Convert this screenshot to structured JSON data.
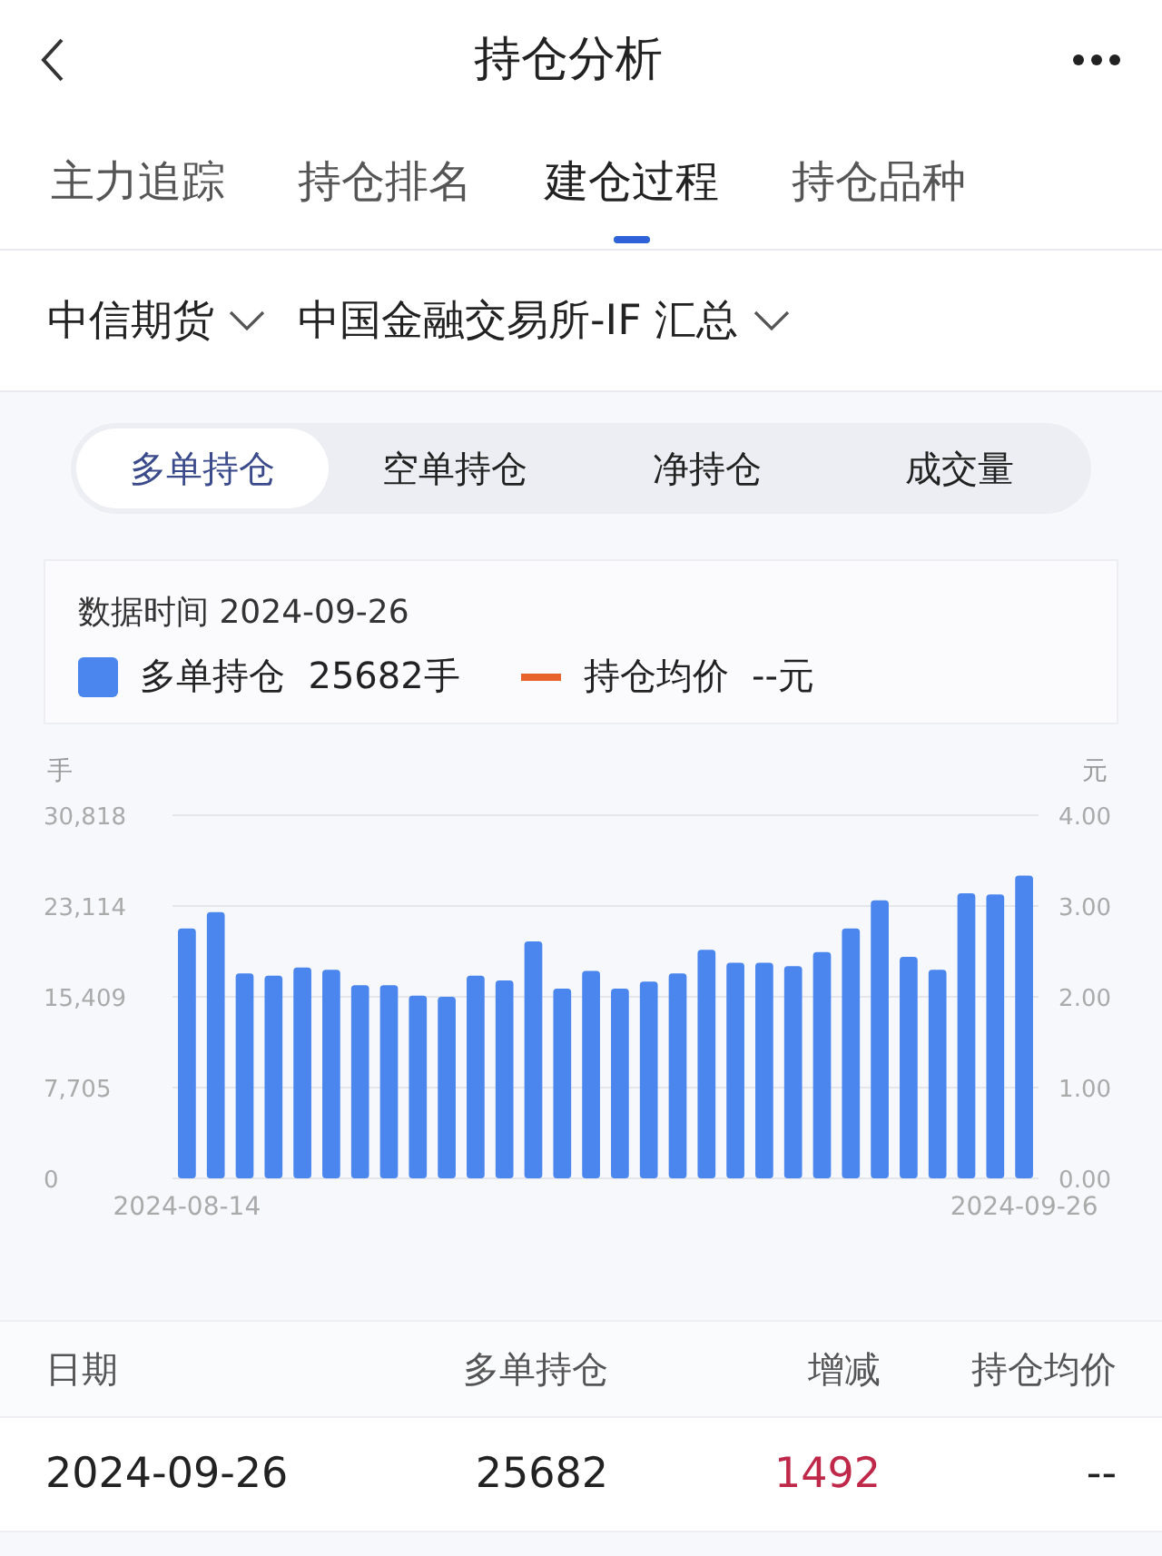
{
  "header": {
    "title": "持仓分析"
  },
  "tabs": [
    {
      "label": "主力追踪",
      "selected": false
    },
    {
      "label": "持仓排名",
      "selected": false
    },
    {
      "label": "建仓过程",
      "selected": true
    },
    {
      "label": "持仓品种",
      "selected": false
    }
  ],
  "filters": [
    {
      "label": "中信期货"
    },
    {
      "label": "中国金融交易所-IF 汇总"
    }
  ],
  "segments": [
    {
      "label": "多单持仓",
      "selected": true
    },
    {
      "label": "空单持仓",
      "selected": false
    },
    {
      "label": "净持仓",
      "selected": false
    },
    {
      "label": "成交量",
      "selected": false
    }
  ],
  "info": {
    "date_text": "数据时间 2024-09-26",
    "legend": [
      {
        "kind": "bar",
        "label": "多单持仓  25682手",
        "color": "#4a86ee"
      },
      {
        "kind": "line",
        "label": "持仓均价  --元",
        "color": "#e8622c"
      }
    ]
  },
  "chart": {
    "y_unit": "手",
    "y2_unit": "元",
    "chart_data": {
      "type": "bar",
      "ylim": [
        0,
        30818
      ],
      "yticks": [
        {
          "value": 0,
          "label": "0"
        },
        {
          "value": 7705,
          "label": "7,705"
        },
        {
          "value": 15409,
          "label": "15,409"
        },
        {
          "value": 23114,
          "label": "23,114"
        },
        {
          "value": 30818,
          "label": "30,818"
        }
      ],
      "y2ticks": [
        "0.00",
        "1.00",
        "2.00",
        "3.00",
        "4.00"
      ],
      "grid": true,
      "categories": [
        "2024-08-14",
        null,
        null,
        null,
        null,
        null,
        null,
        null,
        null,
        null,
        null,
        null,
        null,
        null,
        null,
        null,
        null,
        null,
        null,
        null,
        null,
        null,
        null,
        null,
        null,
        null,
        null,
        null,
        null,
        "2024-09-26"
      ],
      "series": [
        {
          "color": "#4a86ee",
          "values": [
            21200,
            22600,
            17400,
            17200,
            17900,
            17700,
            16400,
            16400,
            15500,
            15400,
            17200,
            16800,
            20100,
            16100,
            17600,
            16100,
            16700,
            17400,
            19400,
            18300,
            18300,
            18000,
            19200,
            21200,
            23600,
            18800,
            17700,
            24200,
            24100,
            25700
          ]
        }
      ]
    }
  },
  "table": {
    "columns": [
      "日期",
      "多单持仓",
      "增减",
      "持仓均价"
    ],
    "rows": [
      {
        "cells": [
          "2024-09-26",
          "25682",
          "1492",
          "--"
        ]
      }
    ]
  }
}
